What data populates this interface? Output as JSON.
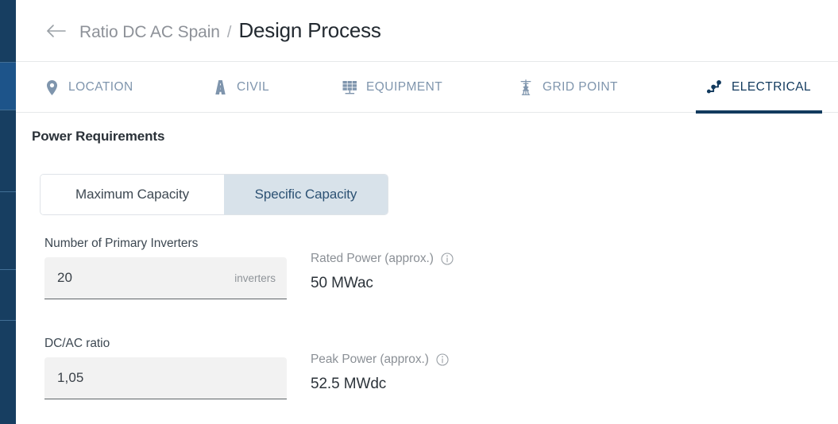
{
  "rail": {
    "name": "app-nav-rail",
    "segments": [
      {
        "id": "seg-1",
        "active": false
      },
      {
        "id": "seg-2",
        "active": true
      },
      {
        "id": "seg-3",
        "active": false
      },
      {
        "id": "seg-4",
        "active": false
      },
      {
        "id": "seg-5",
        "active": false
      },
      {
        "id": "seg-6",
        "active": false
      }
    ],
    "color_base": "#173e61",
    "color_active": "#1d548a"
  },
  "header": {
    "back_icon": "arrow-left-icon",
    "breadcrumb": {
      "parent": "Ratio DC AC Spain",
      "separator": "/",
      "current": "Design Process"
    }
  },
  "tabs": {
    "active_id": "electrical",
    "active_color": "#123a5e",
    "inactive_color": "#7f95ad",
    "items": [
      {
        "id": "location",
        "label": "LOCATION",
        "icon": "map-pin-icon"
      },
      {
        "id": "civil",
        "label": "CIVIL",
        "icon": "road-icon"
      },
      {
        "id": "equipment",
        "label": "EQUIPMENT",
        "icon": "solar-panel-icon"
      },
      {
        "id": "grid-point",
        "label": "GRID POINT",
        "icon": "transmission-tower-icon"
      },
      {
        "id": "electrical",
        "label": "ELECTRICAL",
        "icon": "circuit-node-icon"
      }
    ]
  },
  "main": {
    "section_title": "Power Requirements",
    "capacity_mode": {
      "selected": "specific",
      "options": [
        {
          "id": "maximum",
          "label": "Maximum Capacity"
        },
        {
          "id": "specific",
          "label": "Specific Capacity"
        }
      ]
    },
    "fields": [
      {
        "id": "primary-inverters",
        "label": "Number of Primary Inverters",
        "value": "20",
        "unit": "inverters"
      },
      {
        "id": "dc-ac-ratio",
        "label": "DC/AC ratio",
        "value": "1,05",
        "unit": ""
      }
    ],
    "readouts": [
      {
        "id": "rated-power",
        "label": "Rated Power (approx.)",
        "value": "50 MWac",
        "info_icon": "info-circle-icon"
      },
      {
        "id": "peak-power",
        "label": "Peak Power (approx.)",
        "value": "52.5 MWdc",
        "info_icon": "info-circle-icon"
      }
    ]
  }
}
